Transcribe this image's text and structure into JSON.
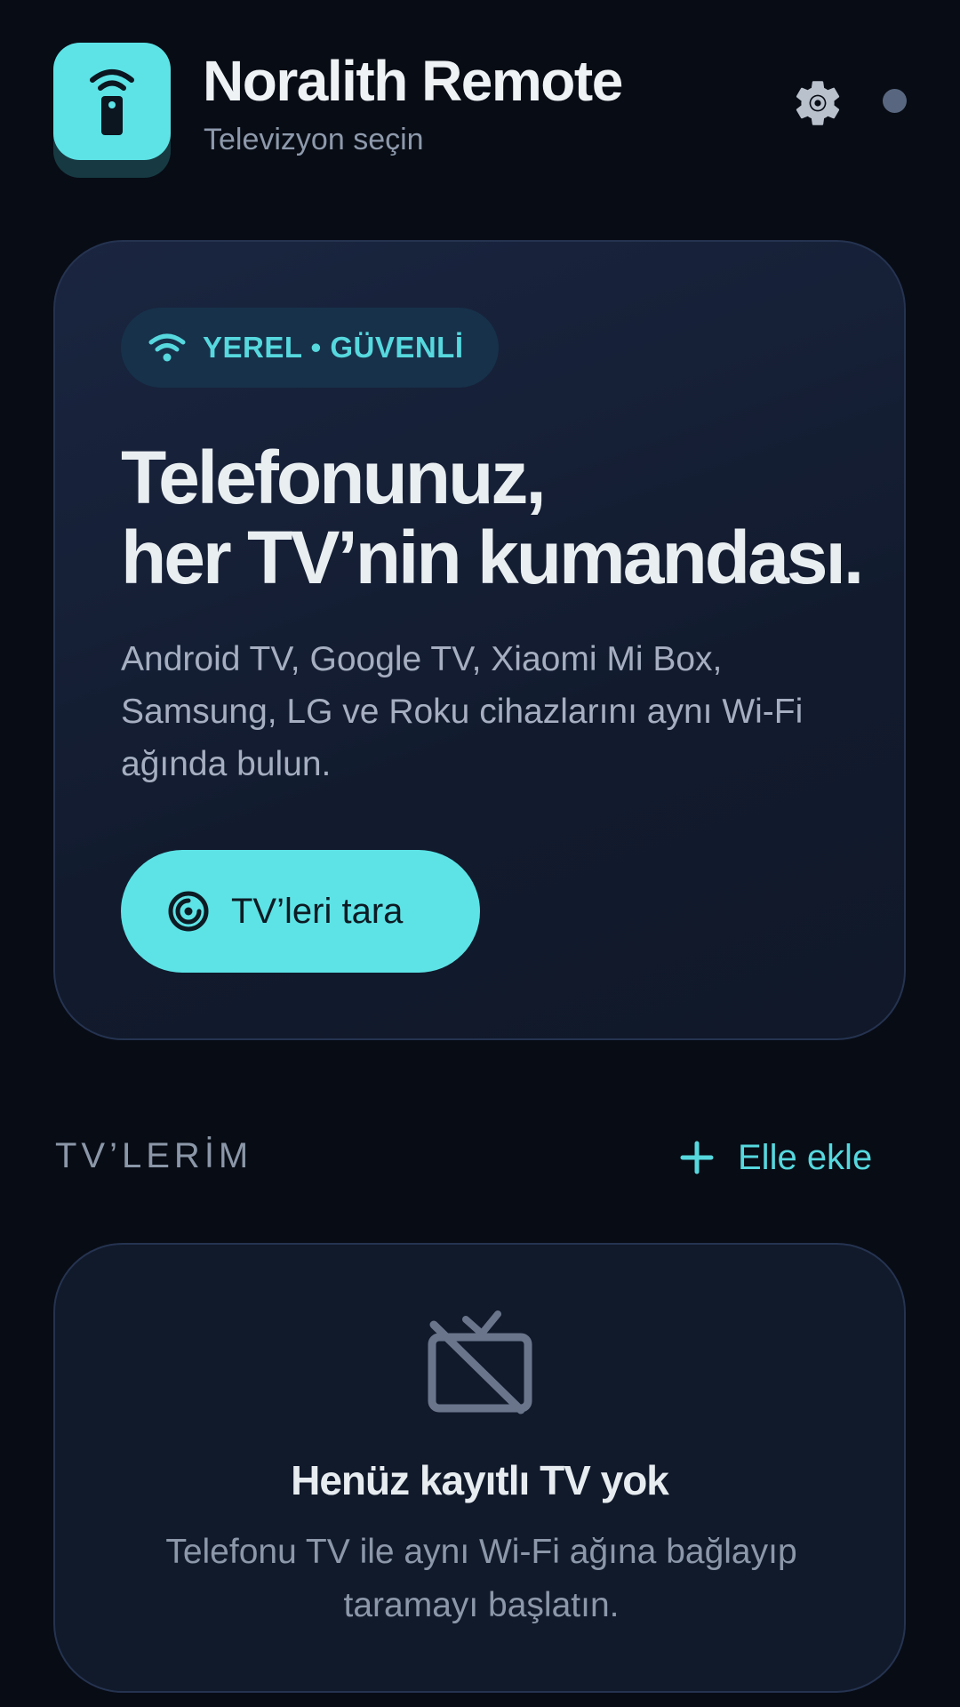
{
  "header": {
    "app_name": "Noralith Remote",
    "subtitle": "Televizyon seçin",
    "app_icon": "remote-icon",
    "settings_icon": "gear-icon"
  },
  "hero": {
    "badge_icon": "wifi-icon",
    "badge_label": "YEREL • GÜVENLİ",
    "headline_line1": "Telefonunuz,",
    "headline_line2": "her TV’nin kumandası.",
    "description": "Android TV, Google TV, Xiaomi Mi Box, Samsung, LG ve Roku cihazlarını aynı Wi-Fi ağında bulun.",
    "scan_button": {
      "icon": "radar-icon",
      "label": "TV’leri tara"
    }
  },
  "my_tvs": {
    "section_title": "TV’LERİM",
    "add_button": {
      "icon": "plus-icon",
      "label": "Elle ekle"
    },
    "empty_state": {
      "icon": "tv-off-icon",
      "title": "Henüz kayıtlı TV yok",
      "text": "Telefonu TV ile aynı Wi-Fi ağına bağlayıp taramayı başlatın."
    }
  },
  "colors": {
    "background": "#080c15",
    "accent": "#5de3e6",
    "card": "#121b2e",
    "muted_text": "#8c98aa"
  }
}
